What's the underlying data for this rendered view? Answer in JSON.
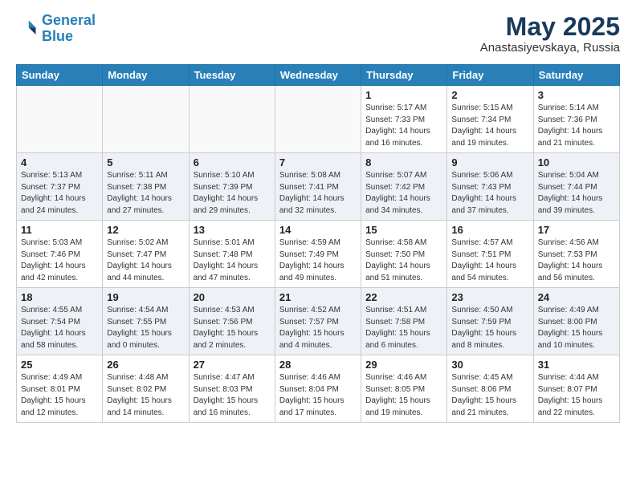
{
  "header": {
    "logo_line1": "General",
    "logo_line2": "Blue",
    "main_title": "May 2025",
    "sub_title": "Anastasiyevskaya, Russia"
  },
  "weekdays": [
    "Sunday",
    "Monday",
    "Tuesday",
    "Wednesday",
    "Thursday",
    "Friday",
    "Saturday"
  ],
  "weeks": [
    [
      {
        "day": "",
        "info": ""
      },
      {
        "day": "",
        "info": ""
      },
      {
        "day": "",
        "info": ""
      },
      {
        "day": "",
        "info": ""
      },
      {
        "day": "1",
        "info": "Sunrise: 5:17 AM\nSunset: 7:33 PM\nDaylight: 14 hours\nand 16 minutes."
      },
      {
        "day": "2",
        "info": "Sunrise: 5:15 AM\nSunset: 7:34 PM\nDaylight: 14 hours\nand 19 minutes."
      },
      {
        "day": "3",
        "info": "Sunrise: 5:14 AM\nSunset: 7:36 PM\nDaylight: 14 hours\nand 21 minutes."
      }
    ],
    [
      {
        "day": "4",
        "info": "Sunrise: 5:13 AM\nSunset: 7:37 PM\nDaylight: 14 hours\nand 24 minutes."
      },
      {
        "day": "5",
        "info": "Sunrise: 5:11 AM\nSunset: 7:38 PM\nDaylight: 14 hours\nand 27 minutes."
      },
      {
        "day": "6",
        "info": "Sunrise: 5:10 AM\nSunset: 7:39 PM\nDaylight: 14 hours\nand 29 minutes."
      },
      {
        "day": "7",
        "info": "Sunrise: 5:08 AM\nSunset: 7:41 PM\nDaylight: 14 hours\nand 32 minutes."
      },
      {
        "day": "8",
        "info": "Sunrise: 5:07 AM\nSunset: 7:42 PM\nDaylight: 14 hours\nand 34 minutes."
      },
      {
        "day": "9",
        "info": "Sunrise: 5:06 AM\nSunset: 7:43 PM\nDaylight: 14 hours\nand 37 minutes."
      },
      {
        "day": "10",
        "info": "Sunrise: 5:04 AM\nSunset: 7:44 PM\nDaylight: 14 hours\nand 39 minutes."
      }
    ],
    [
      {
        "day": "11",
        "info": "Sunrise: 5:03 AM\nSunset: 7:46 PM\nDaylight: 14 hours\nand 42 minutes."
      },
      {
        "day": "12",
        "info": "Sunrise: 5:02 AM\nSunset: 7:47 PM\nDaylight: 14 hours\nand 44 minutes."
      },
      {
        "day": "13",
        "info": "Sunrise: 5:01 AM\nSunset: 7:48 PM\nDaylight: 14 hours\nand 47 minutes."
      },
      {
        "day": "14",
        "info": "Sunrise: 4:59 AM\nSunset: 7:49 PM\nDaylight: 14 hours\nand 49 minutes."
      },
      {
        "day": "15",
        "info": "Sunrise: 4:58 AM\nSunset: 7:50 PM\nDaylight: 14 hours\nand 51 minutes."
      },
      {
        "day": "16",
        "info": "Sunrise: 4:57 AM\nSunset: 7:51 PM\nDaylight: 14 hours\nand 54 minutes."
      },
      {
        "day": "17",
        "info": "Sunrise: 4:56 AM\nSunset: 7:53 PM\nDaylight: 14 hours\nand 56 minutes."
      }
    ],
    [
      {
        "day": "18",
        "info": "Sunrise: 4:55 AM\nSunset: 7:54 PM\nDaylight: 14 hours\nand 58 minutes."
      },
      {
        "day": "19",
        "info": "Sunrise: 4:54 AM\nSunset: 7:55 PM\nDaylight: 15 hours\nand 0 minutes."
      },
      {
        "day": "20",
        "info": "Sunrise: 4:53 AM\nSunset: 7:56 PM\nDaylight: 15 hours\nand 2 minutes."
      },
      {
        "day": "21",
        "info": "Sunrise: 4:52 AM\nSunset: 7:57 PM\nDaylight: 15 hours\nand 4 minutes."
      },
      {
        "day": "22",
        "info": "Sunrise: 4:51 AM\nSunset: 7:58 PM\nDaylight: 15 hours\nand 6 minutes."
      },
      {
        "day": "23",
        "info": "Sunrise: 4:50 AM\nSunset: 7:59 PM\nDaylight: 15 hours\nand 8 minutes."
      },
      {
        "day": "24",
        "info": "Sunrise: 4:49 AM\nSunset: 8:00 PM\nDaylight: 15 hours\nand 10 minutes."
      }
    ],
    [
      {
        "day": "25",
        "info": "Sunrise: 4:49 AM\nSunset: 8:01 PM\nDaylight: 15 hours\nand 12 minutes."
      },
      {
        "day": "26",
        "info": "Sunrise: 4:48 AM\nSunset: 8:02 PM\nDaylight: 15 hours\nand 14 minutes."
      },
      {
        "day": "27",
        "info": "Sunrise: 4:47 AM\nSunset: 8:03 PM\nDaylight: 15 hours\nand 16 minutes."
      },
      {
        "day": "28",
        "info": "Sunrise: 4:46 AM\nSunset: 8:04 PM\nDaylight: 15 hours\nand 17 minutes."
      },
      {
        "day": "29",
        "info": "Sunrise: 4:46 AM\nSunset: 8:05 PM\nDaylight: 15 hours\nand 19 minutes."
      },
      {
        "day": "30",
        "info": "Sunrise: 4:45 AM\nSunset: 8:06 PM\nDaylight: 15 hours\nand 21 minutes."
      },
      {
        "day": "31",
        "info": "Sunrise: 4:44 AM\nSunset: 8:07 PM\nDaylight: 15 hours\nand 22 minutes."
      }
    ]
  ]
}
